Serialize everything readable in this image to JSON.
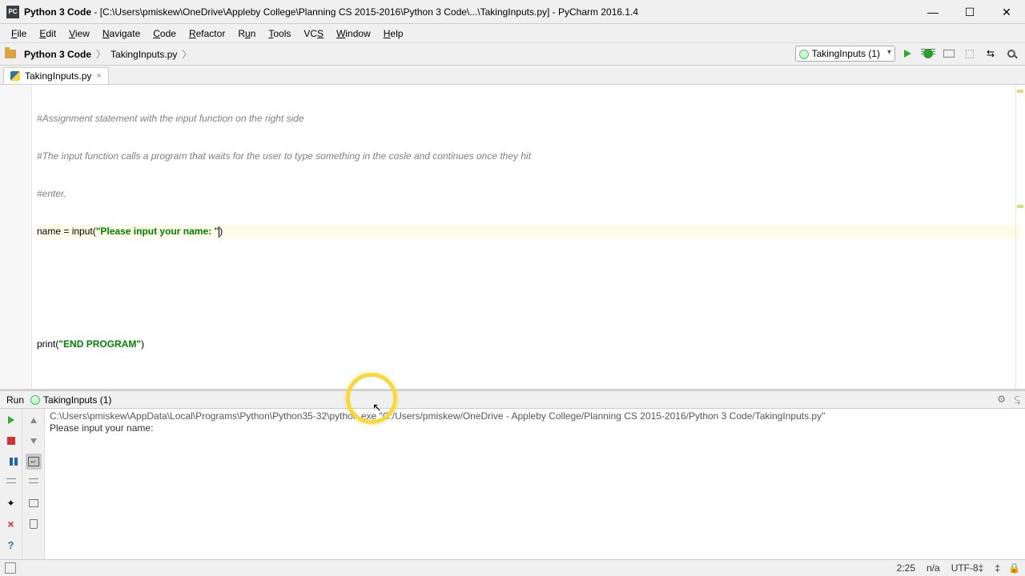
{
  "window": {
    "title_prefix": "Python 3 Code",
    "title_path": "[C:\\Users\\pmiskew\\OneDrive\\Appleby College\\Planning CS 2015-2016\\Python 3 Code\\...\\TakingInputs.py]",
    "ide": "PyCharm 2016.1.4",
    "min": "—",
    "max": "☐",
    "close": "✕"
  },
  "menu": [
    "File",
    "Edit",
    "View",
    "Navigate",
    "Code",
    "Refactor",
    "Run",
    "Tools",
    "VCS",
    "Window",
    "Help"
  ],
  "breadcrumb": {
    "root": "Python 3 Code",
    "file": "TakingInputs.py",
    "sep": "〉"
  },
  "run_config": {
    "label": "TakingInputs (1)"
  },
  "tab": {
    "name": "TakingInputs.py"
  },
  "code": {
    "c1": "#Assignment statement with the input function on the right side",
    "c2": "#The input function calls a program that waits for the user to type something in the cosle and continues once they hit",
    "c3": "#enter.",
    "assign_pre": "name = input(",
    "assign_str": "\"Please input your name: \"",
    "assign_post": ")",
    "print_pre": "print(",
    "print_str": "\"END PROGRAM\"",
    "print_post": ")"
  },
  "run": {
    "panel_label": "Run",
    "config_name": "TakingInputs (1)",
    "exe_line": "C:\\Users\\pmiskew\\AppData\\Local\\Programs\\Python\\Python35-32\\python.exe \"C:/Users/pmiskew/OneDrive - Appleby College/Planning CS 2015-2016/Python 3 Code/TakingInputs.py\"",
    "prompt": "Please input your name: "
  },
  "status": {
    "pos": "2:25",
    "sep": "n/a",
    "enc": "UTF-8‡",
    "end": "‡"
  }
}
